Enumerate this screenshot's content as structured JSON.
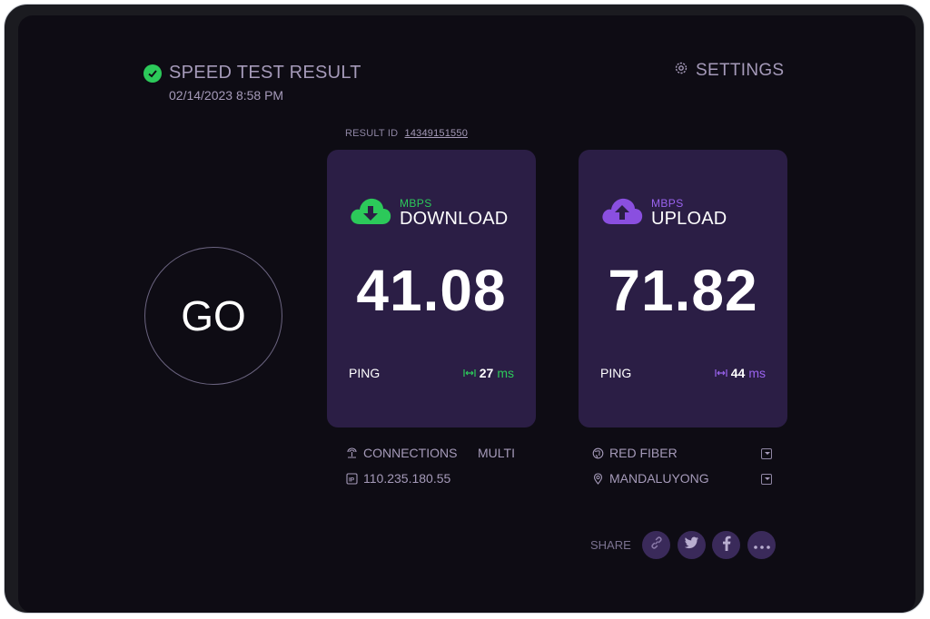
{
  "header": {
    "title": "SPEED TEST RESULT",
    "datetime": "02/14/2023 8:58 PM",
    "settings_label": "SETTINGS"
  },
  "result": {
    "label": "RESULT ID",
    "id": "14349151550"
  },
  "go_label": "GO",
  "download": {
    "unit": "MBPS",
    "label": "DOWNLOAD",
    "value": "41.08",
    "ping_label": "PING",
    "ping_value": "27",
    "ping_unit": "ms"
  },
  "upload": {
    "unit": "MBPS",
    "label": "UPLOAD",
    "value": "71.82",
    "ping_label": "PING",
    "ping_value": "44",
    "ping_unit": "ms"
  },
  "connection": {
    "label": "CONNECTIONS",
    "value": "MULTI",
    "ip": "110.235.180.55"
  },
  "provider": {
    "isp": "RED FIBER",
    "location": "MANDALUYONG"
  },
  "share": {
    "label": "SHARE",
    "buttons": [
      "link-icon",
      "twitter-icon",
      "facebook-icon",
      "more-icon"
    ]
  },
  "colors": {
    "download_accent": "#2cc95a",
    "upload_accent": "#8a4fe0",
    "card_bg": "#2b1e45",
    "screen_bg": "#0e0c14"
  }
}
